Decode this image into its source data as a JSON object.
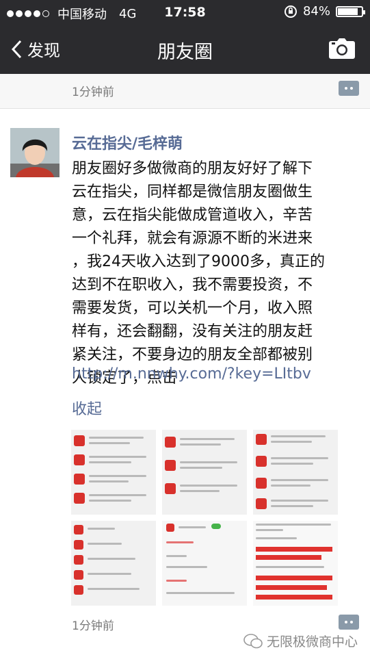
{
  "status_bar": {
    "carrier": "中国移动",
    "network": "4G",
    "time": "17:58",
    "battery": "84%",
    "battery_level": 0.84
  },
  "nav": {
    "back_label": "发现",
    "title": "朋友圈"
  },
  "previous_post": {
    "time": "1分钟前"
  },
  "post": {
    "author": "云在指尖/毛梓萌",
    "lines": [
      "朋友圈好多做微商的朋友好好了解下",
      "云在指尖，同样都是微信朋友圈做生",
      "意，云在指尖能做成管道收入，辛苦",
      "一个礼拜，就会有源源不断的米进来",
      "，我24天收入达到了9000多，真正的",
      "达到不在职收入，我不需要投资，不",
      "需要发货，可以关机一个月，收入照",
      "样有，还会翻翻，没有关注的朋友赶",
      "紧关注，不要身边的朋友全部都被别",
      "人锁定了，点击"
    ],
    "link": "http://m.nnwhy.com/?key=LItbv",
    "collapse_label": "收起",
    "time": "1分钟前"
  },
  "watermark": {
    "text": "无限极微商中心"
  },
  "icons": {
    "back": "chevron-left-icon",
    "camera": "camera-icon",
    "comment": "comment-icon",
    "wechat": "wechat-logo-icon"
  }
}
